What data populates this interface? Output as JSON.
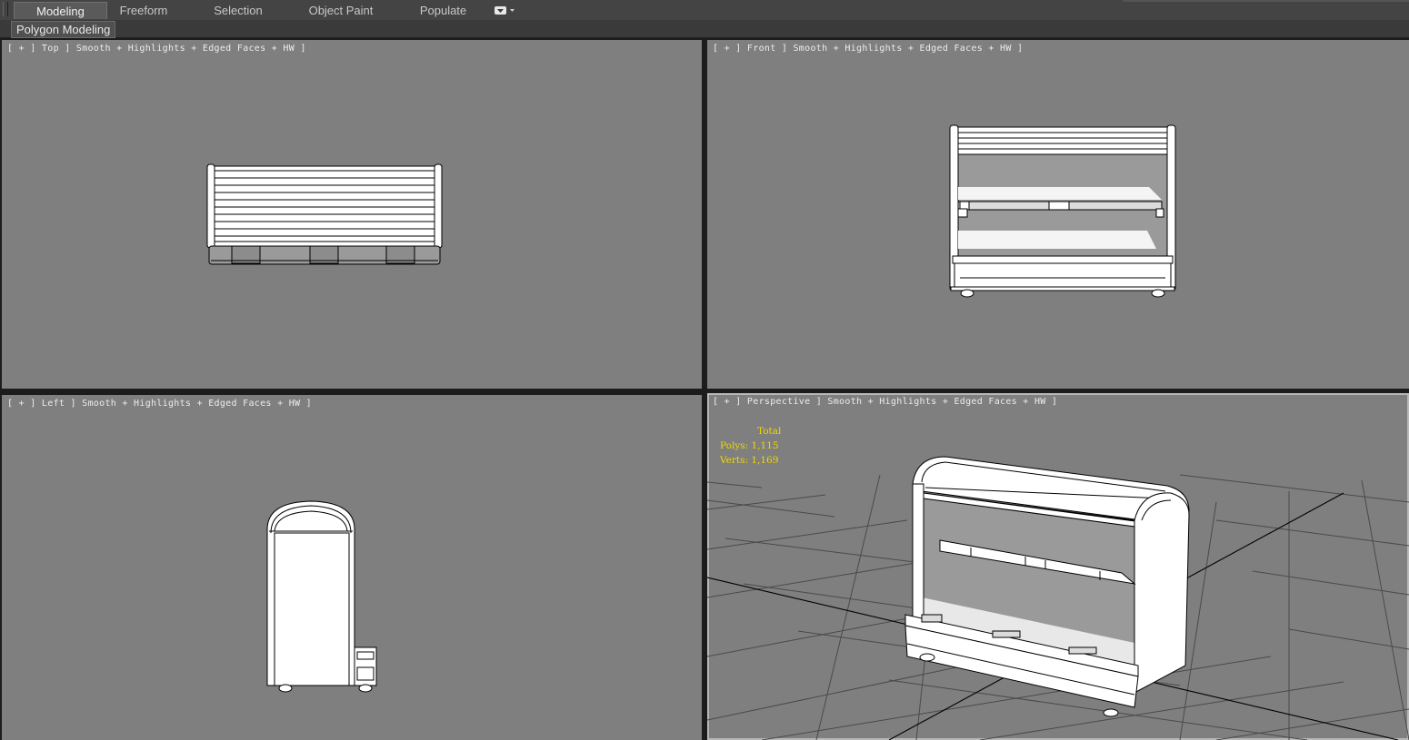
{
  "ribbon": {
    "tabs": [
      {
        "label": "Modeling",
        "active": true
      },
      {
        "label": "Freeform",
        "active": false
      },
      {
        "label": "Selection",
        "active": false
      },
      {
        "label": "Object Paint",
        "active": false
      },
      {
        "label": "Populate",
        "active": false
      }
    ],
    "dropdown_icon": "dropdown-menu-icon",
    "panel_label": "Polygon Modeling"
  },
  "viewports": [
    {
      "name": "top",
      "label": "[ + ] Top ] Smooth + Highlights + Edged Faces + HW ]"
    },
    {
      "name": "front",
      "label": "[ + ] Front ] Smooth + Highlights + Edged Faces + HW ]"
    },
    {
      "name": "left",
      "label": "[ + ] Left ] Smooth + Highlights + Edged Faces + HW ]"
    },
    {
      "name": "perspective",
      "label": "[ + ] Perspective ] Smooth + Highlights + Edged Faces + HW ]"
    }
  ],
  "stats": {
    "title": "Total",
    "polys": "Polys: 1,115",
    "verts": "Verts: 1,169"
  },
  "colors": {
    "viewport_bg": "#7f7f7f",
    "stats_text": "#f0d800",
    "ribbon_bg": "#444444",
    "wire": "#000000",
    "model_fill": "#ffffff"
  }
}
